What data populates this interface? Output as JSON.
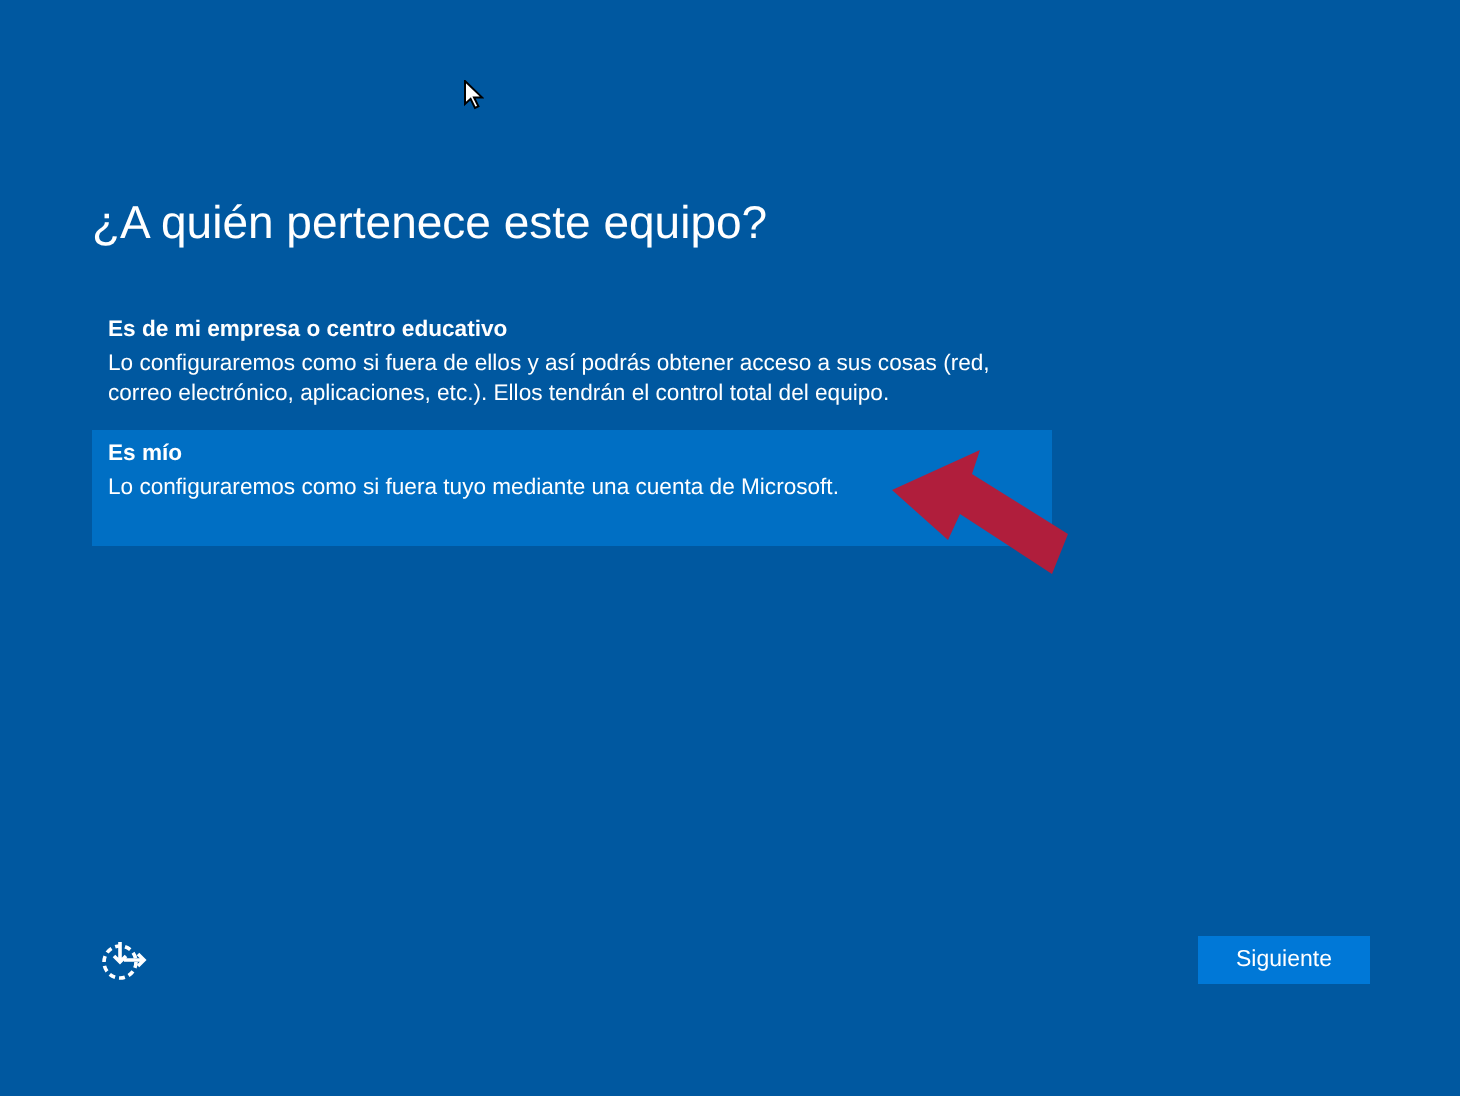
{
  "title": "¿A quién pertenece este equipo?",
  "options": [
    {
      "heading": "Es de mi empresa o centro educativo",
      "description": "Lo configuraremos como si fuera de ellos y así podrás obtener acceso a sus cosas (red, correo electrónico, aplicaciones, etc.). Ellos tendrán el control total del equipo.",
      "selected": false
    },
    {
      "heading": "Es mío",
      "description": "Lo configuraremos como si fuera tuyo mediante una cuenta de Microsoft.",
      "selected": true
    }
  ],
  "next_button": "Siguiente"
}
